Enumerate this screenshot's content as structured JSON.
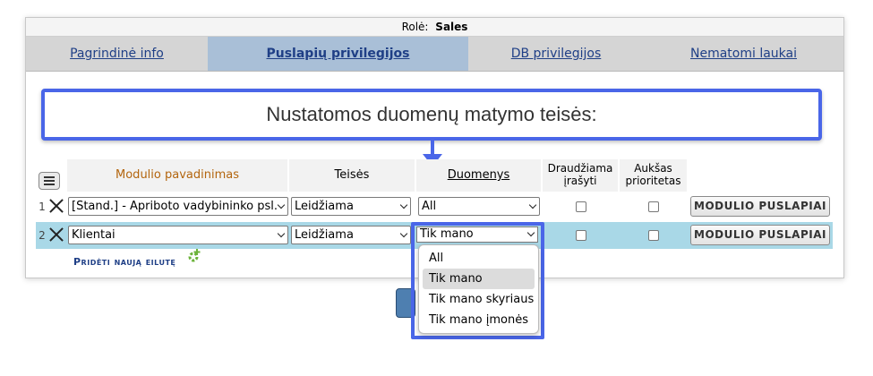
{
  "header": {
    "role_label": "Rolė:",
    "role_value": "Sales"
  },
  "tabs": [
    {
      "label": "Pagrindinė info"
    },
    {
      "label": "Puslapių privilegijos",
      "active": true
    },
    {
      "label": "DB privilegijos"
    },
    {
      "label": "Nematomi laukai"
    }
  ],
  "callout": {
    "text": "Nustatomos duomenų matymo teisės:"
  },
  "table": {
    "columns": {
      "module": "Modulio pavadinimas",
      "rights": "Teisės",
      "data": "Duomenys",
      "forbid_l1": "Draudžiama",
      "forbid_l2": "įrašyti",
      "priority_l1": "Aukšas",
      "priority_l2": "prioritetas"
    },
    "rows": [
      {
        "num": "1",
        "module": "[Stand.] - Apriboto vadybininko psl.",
        "rights": "Leidžiama",
        "data": "All",
        "button": "MODULIO PUSLAPIAI"
      },
      {
        "num": "2",
        "module": "Klientai",
        "rights": "Leidžiama",
        "data": "Tik mano",
        "button": "MODULIO PUSLAPIAI"
      }
    ],
    "add_row": "Pridėti naują eilutę"
  },
  "dropdown": {
    "current": "Tik mano",
    "options": [
      "All",
      "Tik mano",
      "Tik mano skyriaus",
      "Tik mano įmonės"
    ],
    "selected_index": 1
  },
  "colors": {
    "accent": "#4a66e8",
    "active_tab": "#a9bfd7",
    "selected_row": "#a9d8e7",
    "link": "#1f3f86"
  }
}
